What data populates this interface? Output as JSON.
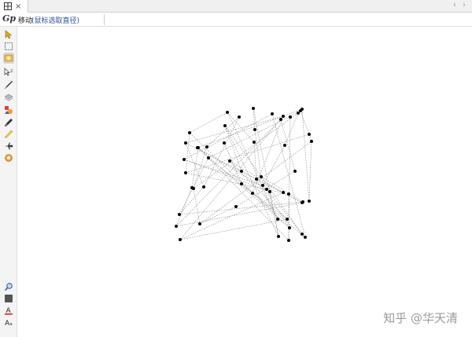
{
  "tab": {
    "close_label": "×"
  },
  "nav": {
    "back": "‹",
    "forward": "›"
  },
  "mode": {
    "name": "移动",
    "hint": "(鼠标选取直径)"
  },
  "logo": {
    "text": "Gp"
  },
  "tools": [
    {
      "name": "move-arrow-icon",
      "active": false
    },
    {
      "name": "select-rect-icon",
      "active": false
    },
    {
      "name": "pan-icon",
      "active": true
    },
    {
      "name": "transform-icon",
      "active": false
    },
    {
      "name": "pen-icon",
      "active": false
    },
    {
      "name": "layers-icon",
      "active": false
    },
    {
      "name": "shapes-icon",
      "active": false
    },
    {
      "name": "brush-icon",
      "active": false
    },
    {
      "name": "pencil-icon",
      "active": false
    },
    {
      "name": "plane-icon",
      "active": false
    },
    {
      "name": "target-icon",
      "active": false
    },
    {
      "name": "zoom-icon",
      "active": false
    },
    {
      "name": "color-box-icon",
      "active": false
    },
    {
      "name": "text-color-icon",
      "active": false
    },
    {
      "name": "text-size-icon",
      "active": false
    }
  ],
  "watermark": "知乎 @华天清",
  "colors": {
    "point": "#000000",
    "line": "#9a9a9a",
    "active_tool": "#d8d8d8"
  }
}
